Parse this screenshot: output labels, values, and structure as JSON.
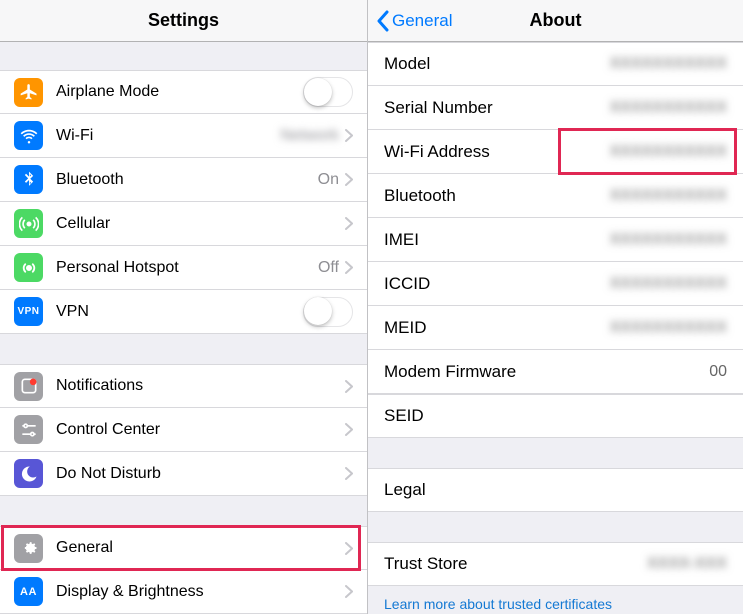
{
  "left": {
    "title": "Settings",
    "groups": [
      [
        {
          "key": "airplane",
          "icon": "airplane",
          "label": "Airplane Mode",
          "type": "toggle"
        },
        {
          "key": "wifi",
          "icon": "wifi",
          "label": "Wi-Fi",
          "type": "nav",
          "detail": ""
        },
        {
          "key": "bluetooth",
          "icon": "bt",
          "label": "Bluetooth",
          "type": "nav",
          "detail": "On"
        },
        {
          "key": "cellular",
          "icon": "cell",
          "label": "Cellular",
          "type": "nav",
          "detail": ""
        },
        {
          "key": "hotspot",
          "icon": "hotspot",
          "label": "Personal Hotspot",
          "type": "nav",
          "detail": "Off"
        },
        {
          "key": "vpn",
          "icon": "vpn",
          "label": "VPN",
          "type": "toggle"
        }
      ],
      [
        {
          "key": "notifications",
          "icon": "notif",
          "label": "Notifications",
          "type": "nav",
          "detail": ""
        },
        {
          "key": "controlcenter",
          "icon": "cc",
          "label": "Control Center",
          "type": "nav",
          "detail": ""
        },
        {
          "key": "dnd",
          "icon": "dnd",
          "label": "Do Not Disturb",
          "type": "nav",
          "detail": ""
        }
      ],
      [
        {
          "key": "general",
          "icon": "general",
          "label": "General",
          "type": "nav",
          "detail": "",
          "highlighted": true
        },
        {
          "key": "display",
          "icon": "display",
          "label": "Display & Brightness",
          "type": "nav",
          "detail": ""
        }
      ]
    ]
  },
  "right": {
    "back": "General",
    "title": "About",
    "rows": [
      {
        "key": "model",
        "label": "Model",
        "value": "",
        "highlighted": false
      },
      {
        "key": "serial",
        "label": "Serial Number",
        "value": "",
        "highlighted": false
      },
      {
        "key": "wifiaddr",
        "label": "Wi-Fi Address",
        "value": "",
        "highlighted": true
      },
      {
        "key": "btaddr",
        "label": "Bluetooth",
        "value": "",
        "highlighted": false
      },
      {
        "key": "imei",
        "label": "IMEI",
        "value": "",
        "highlighted": false
      },
      {
        "key": "iccid",
        "label": "ICCID",
        "value": "",
        "highlighted": false
      },
      {
        "key": "meid",
        "label": "MEID",
        "value": "",
        "highlighted": false
      },
      {
        "key": "modem",
        "label": "Modem Firmware",
        "value": "00",
        "highlighted": false
      }
    ],
    "seid_label": "SEID",
    "legal_label": "Legal",
    "trust_label": "Trust Store",
    "trust_value": "",
    "footer_link": "Learn more about trusted certificates"
  }
}
